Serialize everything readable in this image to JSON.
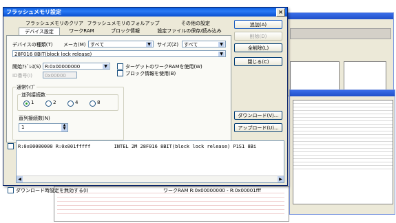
{
  "window": {
    "title": "フラッシュメモリ設定",
    "close_glyph": "×"
  },
  "tabs": [
    {
      "label": "フラッシュメモリのクリア"
    },
    {
      "label": "フラッシュメモリのフォルアップ"
    },
    {
      "label": "その他の設定"
    },
    {
      "label": "デバイス設定"
    },
    {
      "label": "ワークRAM"
    },
    {
      "label": "ブロック情報"
    },
    {
      "label": "設定ファイルの保存/読み込み"
    }
  ],
  "device": {
    "type_label": "デバイスの種類(T)",
    "maker_label": "メーカ(M)",
    "maker_value": "すべて",
    "size_label": "サイズ(Z)",
    "size_value": "すべて",
    "device_value": "28F016 8BIT(block lock release)"
  },
  "address": {
    "start_label": "開始ｱﾄﾞﾚｽ(S)",
    "start_value": "R:0x00000000",
    "id_label": "ID番号(I)",
    "id_value": "0x00000"
  },
  "options": {
    "target_workram": "ターゲットのワークRAMを使用(W)",
    "use_block_info": "ブロック情報を使用(B)"
  },
  "bus": {
    "group_label": "通常ｳｲﾌﾟ",
    "width_label": "並列接続数",
    "width_options": [
      "1",
      "2",
      "4",
      "8"
    ],
    "width_selected": 0,
    "serial_label": "直列接続数(N)",
    "serial_value": "1"
  },
  "buttons": {
    "add": "追加(A)",
    "delete": "削除(D)",
    "delete_all": "全削除(L)",
    "close": "閉じる(C)",
    "download": "ダウンロード(V)...",
    "upload": "アップロード(U)..."
  },
  "list": {
    "rows": [
      {
        "range": "R:0x00000000  R:0x001fffff",
        "desc": "INTEL 2M 28F016 8BIT(block lock release)  P1S1 8Bi"
      }
    ]
  },
  "footer": {
    "disable_label": "ダウンロード時設定を無効する(I)",
    "range_label": "ワークRAM  R:0x00000000 - R:0x00001fff"
  },
  "colors": {
    "titlebar": "#0a5de0",
    "accent": "#21a121",
    "error_text": "#cc0000"
  }
}
